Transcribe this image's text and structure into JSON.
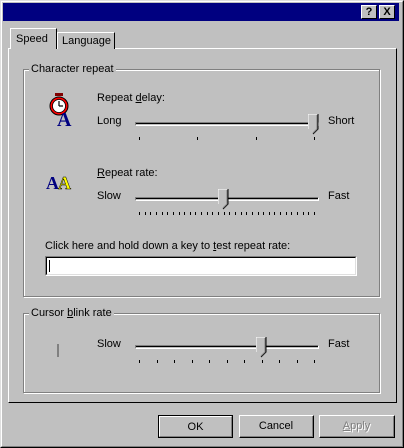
{
  "title_bar": {
    "help_button": "?",
    "close_button": "X"
  },
  "tabs": [
    {
      "label": "Speed",
      "selected": true
    },
    {
      "label": "Language",
      "selected": false
    }
  ],
  "character_repeat": {
    "group_label": "Character repeat",
    "repeat_delay": {
      "label_pre": "Repeat ",
      "label_mnemonic": "d",
      "label_post": "elay:",
      "min_label": "Long",
      "max_label": "Short",
      "ticks": 4,
      "value_position": 3,
      "icon": "stopwatch-a-icon"
    },
    "repeat_rate": {
      "label_mnemonic": "R",
      "label_post": "epeat rate:",
      "min_label": "Slow",
      "max_label": "Fast",
      "ticks": 32,
      "value_position": 15,
      "icon": "double-a-icon"
    },
    "test_prompt_pre": "Click here and hold down a key to ",
    "test_prompt_mnemonic": "t",
    "test_prompt_post": "est repeat rate:",
    "test_value": ""
  },
  "cursor_blink": {
    "group_label_pre": "Cursor ",
    "group_label_mnemonic": "b",
    "group_label_post": "link rate",
    "min_label": "Slow",
    "max_label": "Fast",
    "ticks": 11,
    "value_position": 7,
    "icon": "blinking-cursor-icon"
  },
  "buttons": {
    "ok": "OK",
    "cancel": "Cancel",
    "apply_mnemonic": "A",
    "apply_post": "pply"
  },
  "colors": {
    "face": "#c0c0c0",
    "titlebar": "#000080",
    "disabled_text": "#808080"
  }
}
